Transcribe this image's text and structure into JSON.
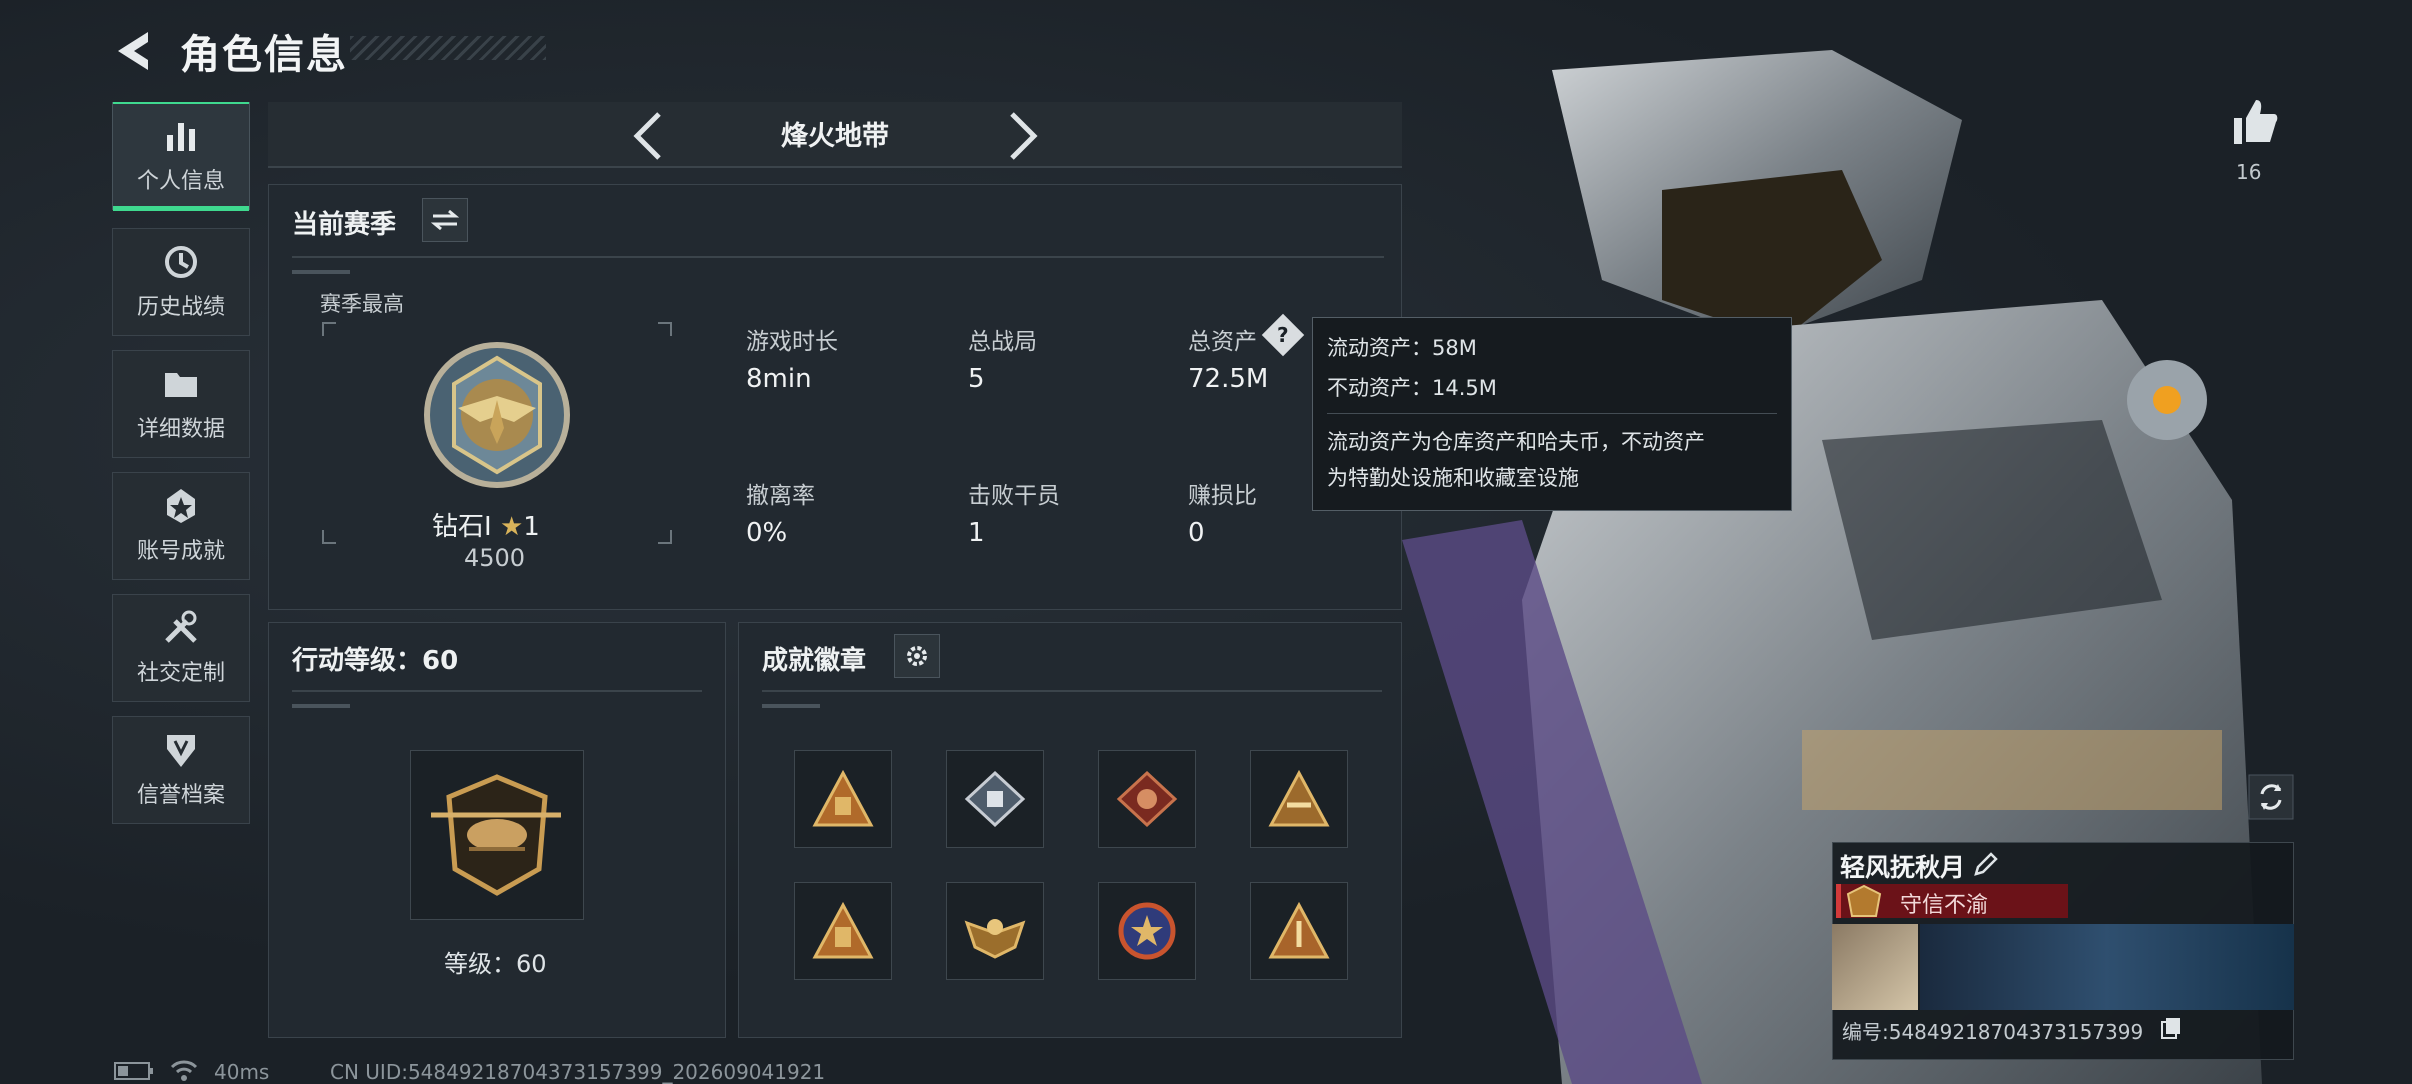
{
  "header": {
    "title": "角色信息"
  },
  "sidebar": {
    "items": [
      {
        "label": "个人信息",
        "icon": "bar-chart-icon",
        "active": true
      },
      {
        "label": "历史战绩",
        "icon": "history-icon"
      },
      {
        "label": "详细数据",
        "icon": "folder-icon"
      },
      {
        "label": "账号成就",
        "icon": "achievement-icon"
      },
      {
        "label": "社交定制",
        "icon": "tools-icon"
      },
      {
        "label": "信誉档案",
        "icon": "shield-icon"
      }
    ]
  },
  "mode_selector": {
    "label": "烽火地带"
  },
  "season_panel": {
    "title": "当前赛季",
    "best_label": "赛季最高",
    "rank_name": "钻石I",
    "rank_stars": "1",
    "rank_score": "4500",
    "stats": [
      {
        "label": "游戏时长",
        "value": "8min"
      },
      {
        "label": "总战局",
        "value": "5"
      },
      {
        "label": "总资产",
        "value": "72.5M"
      },
      {
        "label": "撤离率",
        "value": "0%"
      },
      {
        "label": "击败干员",
        "value": "1"
      },
      {
        "label": "赚损比",
        "value": "0"
      }
    ]
  },
  "tooltip": {
    "liquid": "流动资产：58M",
    "fixed": "不动资产：14.5M",
    "desc_line1": "流动资产为仓库资产和哈夫币，不动资产",
    "desc_line2": "为特勤处设施和收藏室设施"
  },
  "level_panel": {
    "title": "行动等级：60",
    "level_text": "等级：60"
  },
  "badges_panel": {
    "title": "成就徽章",
    "badges": [
      "badge-1",
      "badge-2",
      "badge-3",
      "badge-4",
      "badge-5",
      "badge-6",
      "badge-7",
      "badge-8"
    ]
  },
  "character": {
    "likes": "16",
    "player_name": "轻风抚秋月",
    "title": "守信不渝",
    "uid_line": "编号:5484921870437315739​9"
  },
  "status_bar": {
    "ping": "40ms",
    "uid": "CN UID:5484921870437315739​9_202609041921"
  },
  "colors": {
    "accent": "#3fd98f",
    "title_red": "#6b1218",
    "panel_bg": "#222930"
  }
}
